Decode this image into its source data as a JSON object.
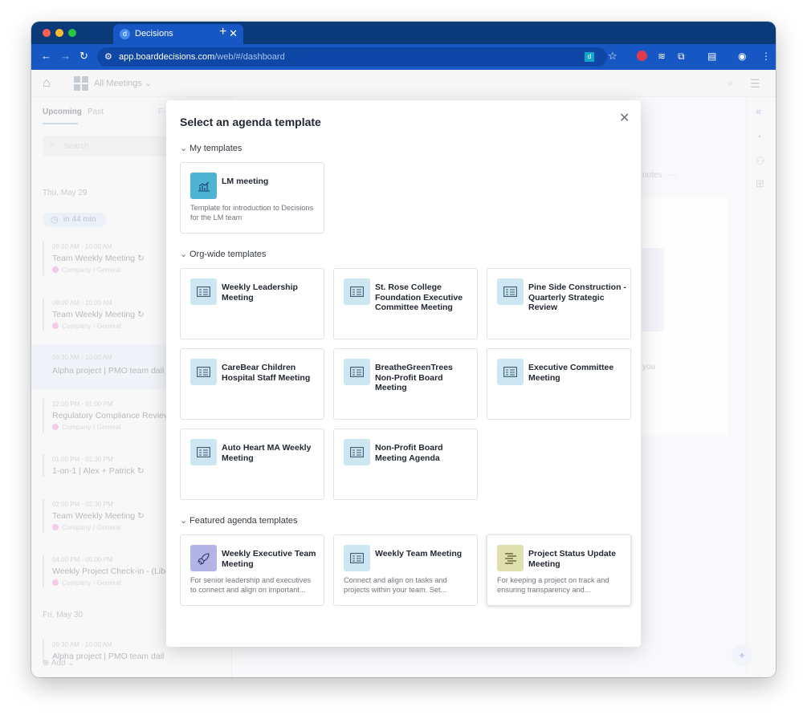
{
  "browser": {
    "tab_title": "Decisions",
    "tab_favicon": "d",
    "new_tab": "+",
    "url_main": "app.boarddecisions.com",
    "url_path": "/web/#/dashboard",
    "ext_badge": "d"
  },
  "app": {
    "view_selector": "All Meetings",
    "sidebar": {
      "tab_upcoming": "Upcoming",
      "tab_past": "Past",
      "tab_filter": "Fi",
      "search_placeholder": "Search",
      "date1": "Thu, May 29",
      "badge": "in 44 min",
      "events": [
        {
          "time": "09:00 AM - 10:00 AM",
          "title": "Team Weekly Meeting",
          "sub": "Company / General"
        },
        {
          "time": "09:00 AM - 10:00 AM",
          "title": "Team Weekly Meeting",
          "sub": "Company / General"
        },
        {
          "time": "09:30 AM - 10:00 AM",
          "title": "Alpha project | PMO team dail",
          "sub": ""
        },
        {
          "time": "12:00 PM - 01:00 PM",
          "title": "Regulatory Compliance Review",
          "sub": "Company / General"
        },
        {
          "time": "01:00 PM - 01:30 PM",
          "title": "1-on-1 | Alex + Patrick",
          "sub": ""
        },
        {
          "time": "02:00 PM - 02:30 PM",
          "title": "Team Weekly Meeting",
          "sub": "Company / General"
        },
        {
          "time": "04:00 PM - 05:00 PM",
          "title": "Weekly Project Check-in - (Libe",
          "sub": "Company / General"
        },
        {
          "time": "09:30 AM - 10:00 AM",
          "title": "Alpha project | PMO team dail",
          "sub": ""
        }
      ],
      "date2": "Fri, May 30",
      "add_label": "Add"
    },
    "background": {
      "notes": "notes",
      "you": "you"
    }
  },
  "modal": {
    "title": "Select an agenda template",
    "sections": {
      "my": "My templates",
      "org": "Org-wide templates",
      "featured": "Featured agenda templates"
    },
    "my_templates": [
      {
        "title": "LM meeting",
        "desc": "Template for introduction to Decisions for the LM team",
        "icon": "chart-icon"
      }
    ],
    "org_templates": [
      {
        "title": "Weekly Leadership Meeting",
        "icon": "document-icon"
      },
      {
        "title": "St. Rose College Foundation Executive Committee Meeting",
        "icon": "document-icon"
      },
      {
        "title": "Pine Side Construction - Quarterly Strategic Review",
        "icon": "document-icon"
      },
      {
        "title": "CareBear Children Hospital Staff Meeting",
        "icon": "document-icon"
      },
      {
        "title": "BreatheGreenTrees Non-Profit Board Meeting",
        "icon": "document-icon"
      },
      {
        "title": "Executive Committee Meeting",
        "icon": "document-icon"
      },
      {
        "title": "Auto Heart MA Weekly Meeting",
        "icon": "document-icon"
      },
      {
        "title": "Non-Profit Board Meeting Agenda",
        "icon": "document-icon"
      }
    ],
    "featured_templates": [
      {
        "title": "Weekly Executive Team Meeting",
        "desc": "For senior leadership and executives to connect and align on important...",
        "icon": "rocket-icon"
      },
      {
        "title": "Weekly Team Meeting",
        "desc": "Connect and align on tasks and projects within your team. Set...",
        "icon": "document-icon"
      },
      {
        "title": "Project Status Update Meeting",
        "desc": "For keeping a project on track and ensuring transparency and...",
        "icon": "list-icon"
      }
    ]
  }
}
